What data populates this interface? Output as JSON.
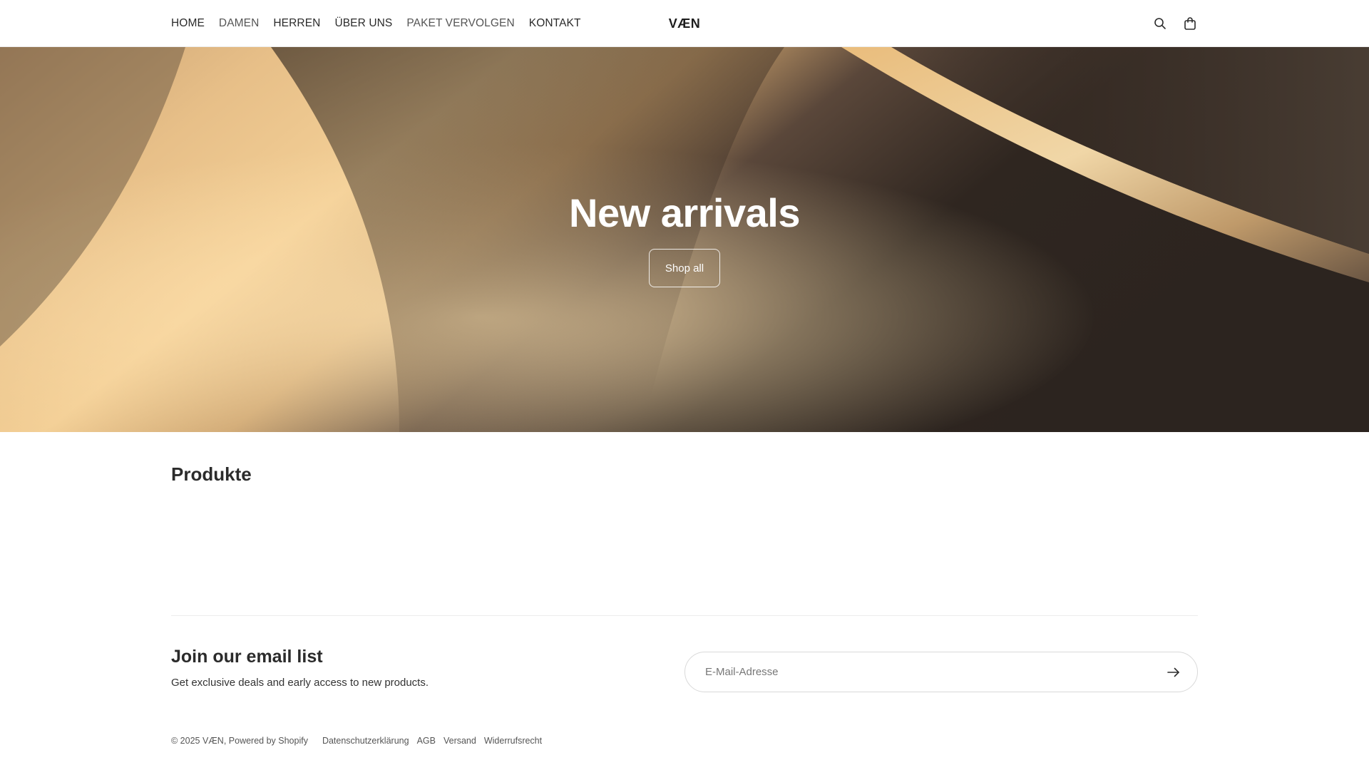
{
  "header": {
    "nav": [
      {
        "label": "HOME"
      },
      {
        "label": "DAMEN"
      },
      {
        "label": "HERREN"
      },
      {
        "label": "ÜBER UNS"
      },
      {
        "label": "PAKET VERVOLGEN"
      },
      {
        "label": "KONTAKT"
      }
    ],
    "logo": "VÆN",
    "icons": {
      "search": "search-icon",
      "cart": "shopping-bag-icon"
    }
  },
  "hero": {
    "title": "New arrivals",
    "button": "Shop all"
  },
  "products": {
    "title": "Produkte"
  },
  "newsletter": {
    "title": "Join our email list",
    "subtitle": "Get exclusive deals and early access to new products.",
    "placeholder": "E-Mail-Adresse",
    "submit_icon": "arrow-right-icon"
  },
  "footer": {
    "copyright": "© 2025 VÆN, Powered by Shopify",
    "links": [
      {
        "label": "Datenschutzerklärung"
      },
      {
        "label": "AGB"
      },
      {
        "label": "Versand"
      },
      {
        "label": "Widerrufsrecht"
      }
    ]
  },
  "colors": {
    "text": "#2b2b2b",
    "hero_light": "#f6d29a",
    "hero_dark": "#2f2620",
    "border": "#ececec"
  }
}
